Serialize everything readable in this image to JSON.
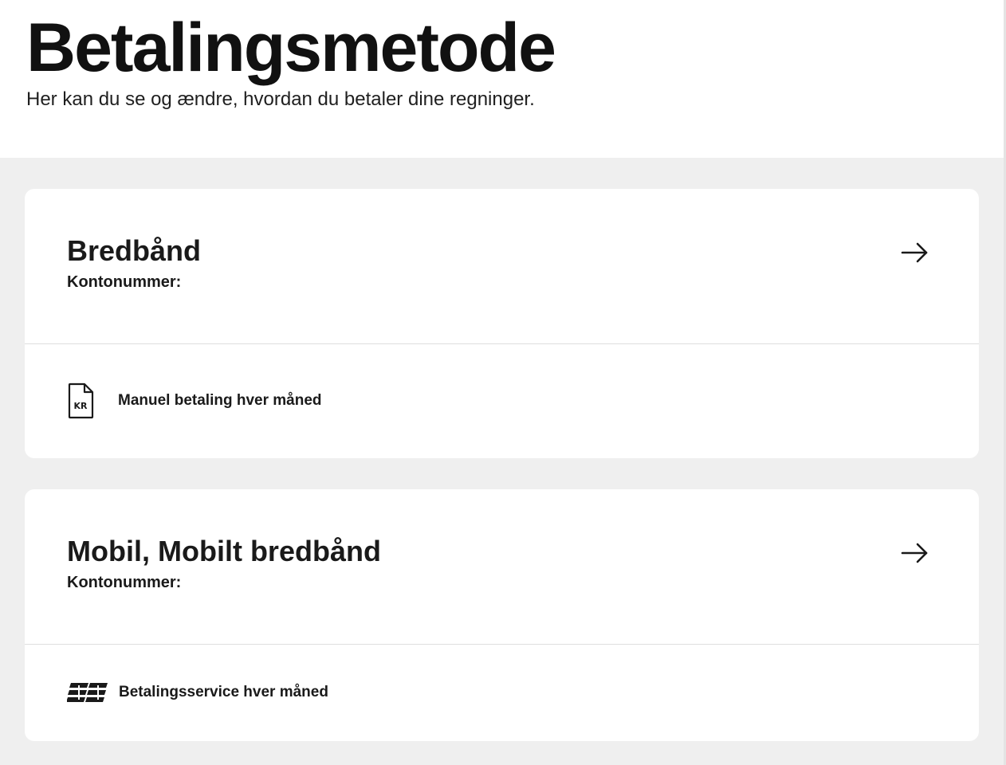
{
  "header": {
    "title": "Betalingsmetode",
    "subtitle": "Her kan du se og ændre, hvordan du betaler dine regninger."
  },
  "cards": [
    {
      "title": "Bredbånd",
      "account_label": "Kontonummer:",
      "account_value": "",
      "method_icon": "kr-invoice-icon",
      "method_label": "Manuel betaling hver måned",
      "action_icon": "arrow-right-icon"
    },
    {
      "title": "Mobil, Mobilt bredbånd",
      "account_label": "Kontonummer:",
      "account_value": "",
      "method_icon": "betalingsservice-icon",
      "method_label": "Betalingsservice hver måned",
      "action_icon": "arrow-right-icon"
    }
  ],
  "colors": {
    "text": "#1a1a1a",
    "background_section": "#efefef",
    "card": "#ffffff",
    "divider": "#dedede"
  }
}
